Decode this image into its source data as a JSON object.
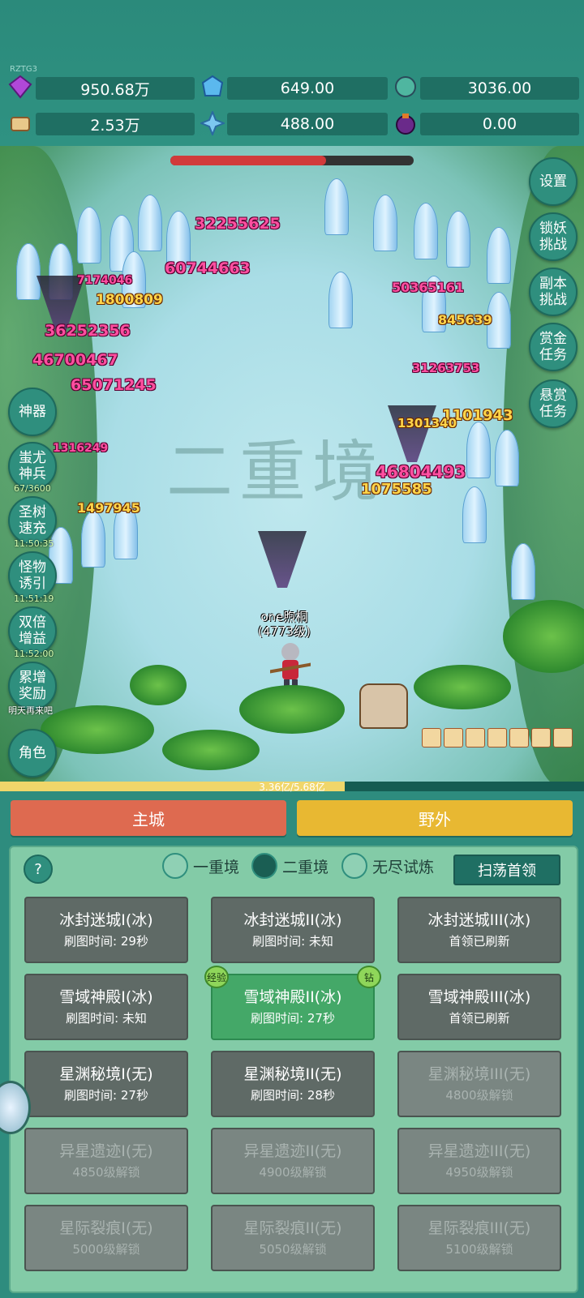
{
  "top": {
    "tag": "RZTG3",
    "resources": [
      {
        "icon": "purple-gem-icon",
        "value": "950.68万"
      },
      {
        "icon": "blue-crystal-icon",
        "value": "649.00"
      },
      {
        "icon": "teal-orb-icon",
        "value": "3036.00"
      },
      {
        "icon": "scroll-icon",
        "value": "2.53万"
      },
      {
        "icon": "ice-shard-icon",
        "value": "488.00"
      },
      {
        "icon": "purple-pouch-icon",
        "value": "0.00"
      }
    ]
  },
  "game": {
    "watermark": "二重境",
    "player_name": "one煦桐",
    "player_level": "(4773级)",
    "boss_hp_percent": 64,
    "damage_numbers": [
      "32255625",
      "60744663",
      "7174046",
      "1800809",
      "36252356",
      "46700467",
      "65071245",
      "50365161",
      "845639",
      "31263753",
      "1101943",
      "1301340",
      "46804493",
      "1075585",
      "1497945",
      "1316249"
    ],
    "left_buttons": [
      {
        "label": "神器",
        "timer": ""
      },
      {
        "label": "蚩尤\n神兵",
        "timer": "67/3600"
      },
      {
        "label": "圣树\n速充",
        "timer": "11:50:35"
      },
      {
        "label": "怪物\n诱引",
        "timer": "11:51:19"
      },
      {
        "label": "双倍\n增益",
        "timer": "11:52:00"
      },
      {
        "label": "累增\n奖励",
        "timer": "明天再来吧"
      },
      {
        "label": "角色",
        "timer": ""
      }
    ],
    "right_buttons": [
      {
        "label": "设置"
      },
      {
        "label": "锁妖\n挑战"
      },
      {
        "label": "副本\n挑战"
      },
      {
        "label": "赏金\n任务"
      },
      {
        "label": "悬赏\n任务"
      }
    ],
    "xp_text": "3.36亿/5.68亿",
    "xp_fraction": 0.59
  },
  "nav": {
    "main_city": "主城",
    "wild": "野外",
    "main_city_color": "#de6a50",
    "wild_color": "#e8b832"
  },
  "panel": {
    "help": "?",
    "tabs": [
      {
        "label": "一重境",
        "selected": false
      },
      {
        "label": "二重境",
        "selected": true
      },
      {
        "label": "无尽试炼",
        "selected": false
      }
    ],
    "sweep_button": "扫荡首领",
    "badges": {
      "left": "经验",
      "right": "钻"
    },
    "stages": [
      {
        "name": "冰封迷城I(冰)",
        "status": "刷图时间: 29秒",
        "state": "normal"
      },
      {
        "name": "冰封迷城II(冰)",
        "status": "刷图时间: 未知",
        "state": "normal"
      },
      {
        "name": "冰封迷城III(冰)",
        "status": "首领已刷新",
        "state": "normal"
      },
      {
        "name": "雪域神殿I(冰)",
        "status": "刷图时间: 未知",
        "state": "normal"
      },
      {
        "name": "雪域神殿II(冰)",
        "status": "刷图时间: 27秒",
        "state": "selected"
      },
      {
        "name": "雪域神殿III(冰)",
        "status": "首领已刷新",
        "state": "normal"
      },
      {
        "name": "星渊秘境I(无)",
        "status": "刷图时间: 27秒",
        "state": "normal"
      },
      {
        "name": "星渊秘境II(无)",
        "status": "刷图时间: 28秒",
        "state": "normal"
      },
      {
        "name": "星渊秘境III(无)",
        "status": "4800级解锁",
        "state": "locked"
      },
      {
        "name": "异星遗迹I(无)",
        "status": "4850级解锁",
        "state": "locked"
      },
      {
        "name": "异星遗迹II(无)",
        "status": "4900级解锁",
        "state": "locked"
      },
      {
        "name": "异星遗迹III(无)",
        "status": "4950级解锁",
        "state": "locked"
      },
      {
        "name": "星际裂痕I(无)",
        "status": "5000级解锁",
        "state": "locked"
      },
      {
        "name": "星际裂痕II(无)",
        "status": "5050级解锁",
        "state": "locked"
      },
      {
        "name": "星际裂痕III(无)",
        "status": "5100级解锁",
        "state": "locked"
      }
    ]
  }
}
